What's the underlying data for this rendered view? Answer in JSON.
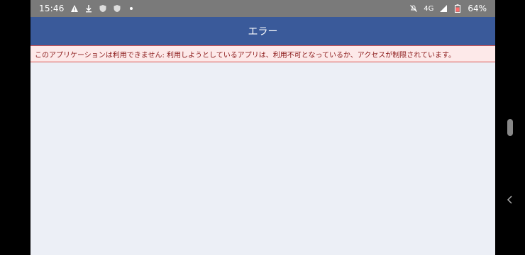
{
  "status_bar": {
    "time": "15:46",
    "network": "4G",
    "battery": "64%",
    "icons": [
      "warning-icon",
      "download-icon",
      "shield-icon",
      "shield-icon",
      "dot-icon",
      "mute-icon",
      "signal-icon",
      "battery-icon"
    ]
  },
  "app": {
    "title": "エラー",
    "error_message": "このアプリケーションは利用できません: 利用しようとしているアプリは、利用不可となっているか、アクセスが制限されています。"
  },
  "colors": {
    "header": "#3a5a9a",
    "banner_bg": "#fde9e9",
    "banner_border": "#d9534f",
    "banner_text": "#8b1a1a",
    "body_bg": "#eceff6"
  }
}
